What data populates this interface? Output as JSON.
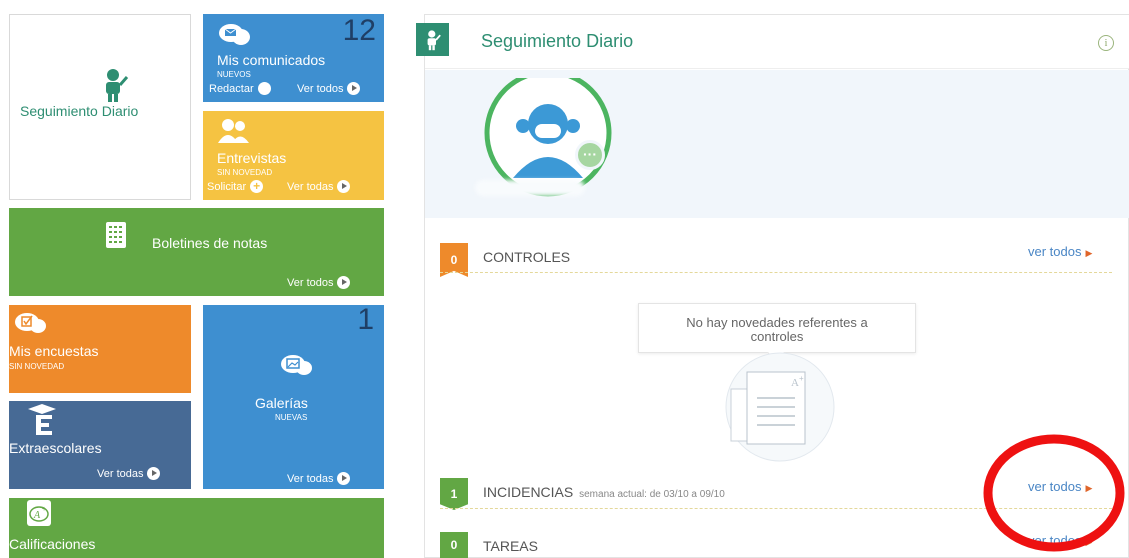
{
  "left": {
    "seguimiento": {
      "label": "Seguimiento Diario"
    },
    "comunicados": {
      "count": "12",
      "title": "Mis comunicados",
      "status": "NUEVOS",
      "redactar": "Redactar",
      "ver": "Ver todos"
    },
    "entrevistas": {
      "title": "Entrevistas",
      "status": "SIN NOVEDAD",
      "solicitar": "Solicitar",
      "ver": "Ver todas"
    },
    "boletines": {
      "title": "Boletines de notas",
      "ver": "Ver todos"
    },
    "encuestas": {
      "title": "Mis encuestas",
      "status": "SIN NOVEDAD"
    },
    "galerias": {
      "count": "1",
      "title": "Galerías",
      "status": "NUEVAS",
      "ver": "Ver todas"
    },
    "extraescolares": {
      "title": "Extraescolares",
      "ver": "Ver todas"
    },
    "calificaciones": {
      "title": "Calificaciones"
    }
  },
  "right": {
    "header": {
      "title": "Seguimiento Diario",
      "info": "i"
    },
    "controles": {
      "count": "0",
      "title": "CONTROLES",
      "ver": "ver todos",
      "empty_msg": "No hay novedades referentes a controles"
    },
    "incidencias": {
      "count": "1",
      "title": "INCIDENCIAS",
      "subtitle": "semana actual: de 03/10 a 09/10",
      "ver": "ver todos"
    },
    "tareas": {
      "count": "0",
      "title": "TAREAS",
      "ver": "ver todos"
    }
  },
  "colors": {
    "green": "#62a744",
    "blue": "#3e8fd0",
    "yellow": "#f5c342",
    "orange": "#ee8a2b",
    "navy": "#476a95",
    "teal": "#2e8e72",
    "annotation_red": "#ee1111"
  }
}
